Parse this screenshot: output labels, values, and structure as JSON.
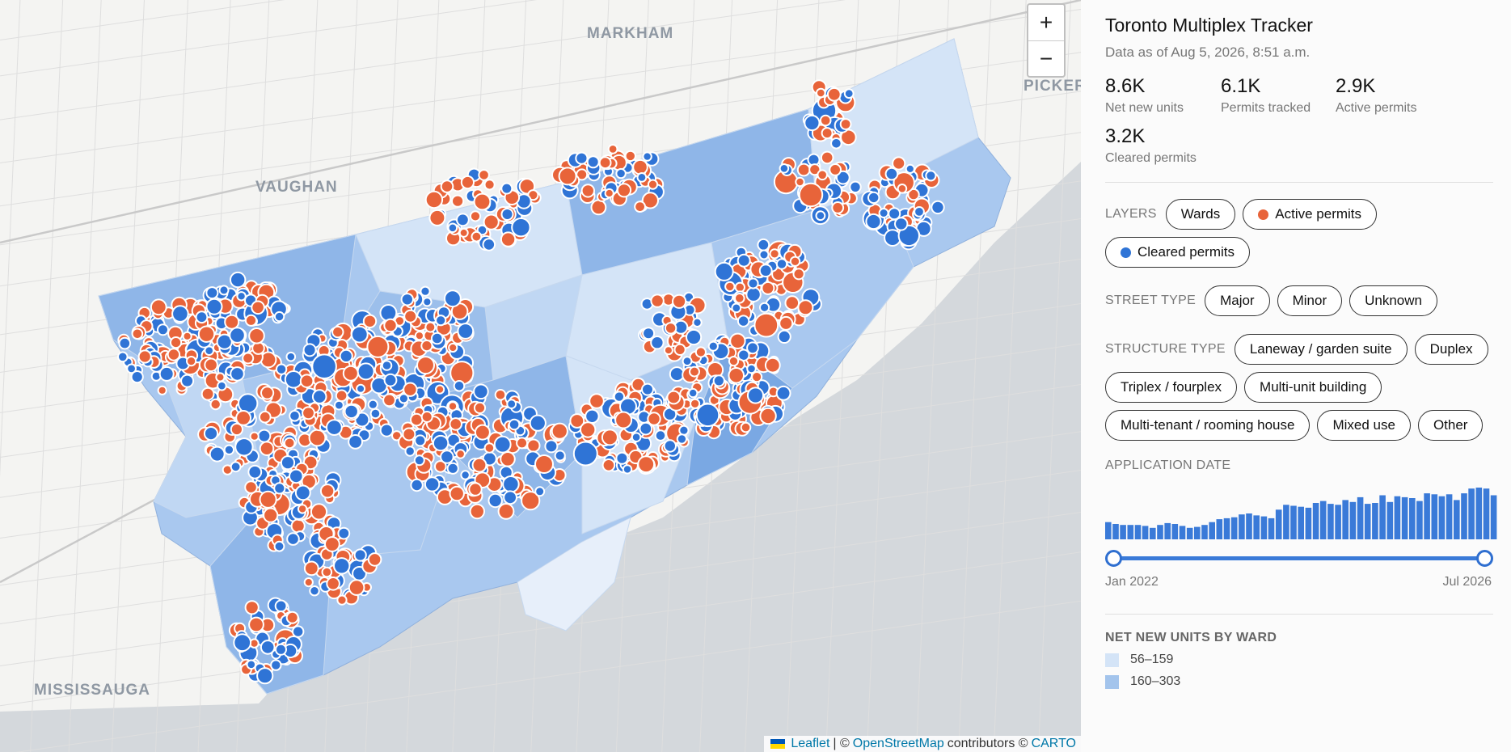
{
  "map": {
    "city_labels": {
      "markham": "MARKHAM",
      "vaughan": "VAUGHAN",
      "pickering": "PICKER",
      "mississauga": "MISSISSAUGA"
    },
    "zoom_in": "+",
    "zoom_out": "−",
    "attribution": {
      "leaflet": "Leaflet",
      "sep1": "| ©",
      "osm": "OpenStreetMap",
      "contrib": "contributors ©",
      "carto": "CARTO"
    },
    "colors": {
      "active": "#e8643a",
      "cleared": "#2f74d6",
      "water": "#d4d8dc"
    }
  },
  "panel": {
    "title": "Toronto Multiplex Tracker",
    "subtitle": "Data as of Aug 5, 2026, 8:51 a.m.",
    "stats": [
      {
        "value": "8.6K",
        "label": "Net new units"
      },
      {
        "value": "6.1K",
        "label": "Permits tracked"
      },
      {
        "value": "2.9K",
        "label": "Active permits"
      },
      {
        "value": "3.2K",
        "label": "Cleared permits"
      }
    ],
    "layers": {
      "title": "LAYERS",
      "wards": "Wards",
      "active": "Active permits",
      "cleared": "Cleared permits"
    },
    "street_type": {
      "title": "STREET TYPE",
      "options": [
        "Major",
        "Minor",
        "Unknown"
      ]
    },
    "structure_type": {
      "title": "STRUCTURE TYPE",
      "options": [
        "Laneway / garden suite",
        "Duplex",
        "Triplex / fourplex",
        "Multi-unit building",
        "Multi-tenant / rooming house",
        "Mixed use",
        "Other"
      ]
    },
    "application_date": {
      "title": "APPLICATION DATE",
      "start_label": "Jan 2022",
      "end_label": "Jul 2026",
      "range": [
        0,
        1
      ],
      "histogram": [
        18,
        16,
        15,
        15,
        15,
        14,
        12,
        15,
        17,
        16,
        14,
        12,
        13,
        15,
        18,
        21,
        22,
        23,
        26,
        27,
        25,
        24,
        22,
        31,
        36,
        35,
        34,
        33,
        38,
        40,
        37,
        36,
        41,
        39,
        44,
        37,
        38,
        46,
        39,
        45,
        44,
        43,
        40,
        48,
        47,
        45,
        47,
        41,
        48,
        53,
        54,
        53,
        46
      ]
    },
    "legend": {
      "title": "NET NEW UNITS BY WARD",
      "items": [
        {
          "label": "56–159",
          "color": "#d4e4f7"
        },
        {
          "label": "160–303",
          "color": "#a3c4ec"
        }
      ]
    }
  }
}
